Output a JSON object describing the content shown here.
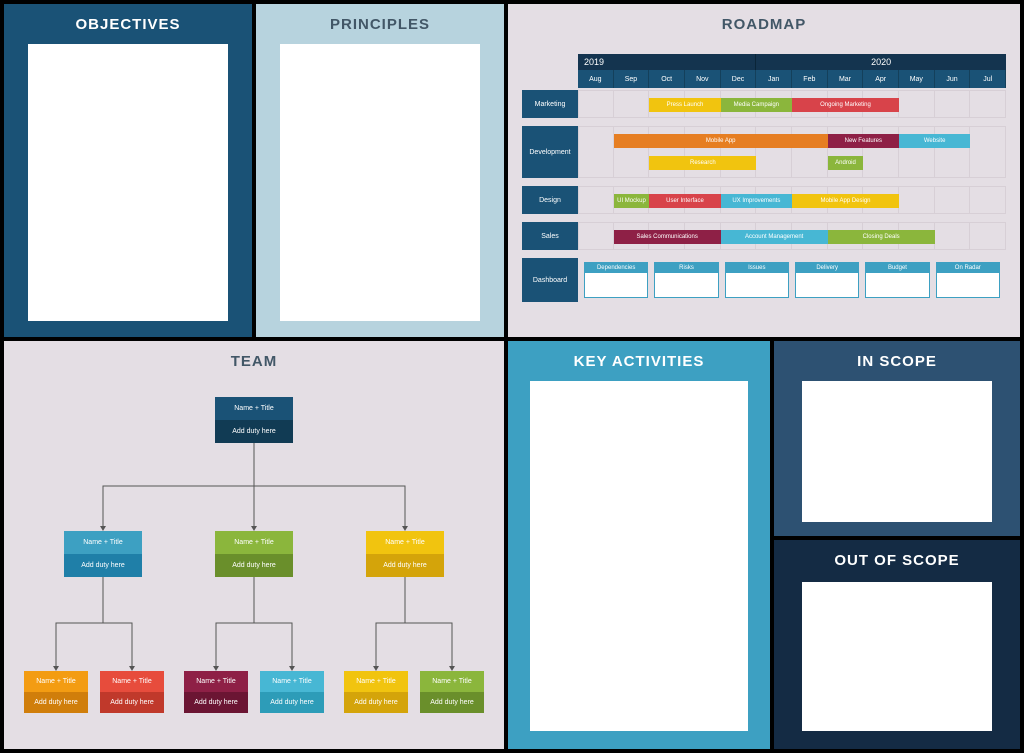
{
  "panels": {
    "objectives": "OBJECTIVES",
    "principles": "PRINCIPLES",
    "roadmap": "ROADMAP",
    "team": "TEAM",
    "key_activities": "KEY ACTIVITIES",
    "in_scope": "IN SCOPE",
    "out_of_scope": "OUT OF SCOPE"
  },
  "roadmap": {
    "years": [
      "2019",
      "2020"
    ],
    "months": [
      "Aug",
      "Sep",
      "Oct",
      "Nov",
      "Dec",
      "Jan",
      "Feb",
      "Mar",
      "Apr",
      "May",
      "Jun",
      "Jul"
    ],
    "rows": {
      "marketing": {
        "label": "Marketing",
        "items": [
          {
            "label": "Press Launch",
            "start": 2,
            "span": 2,
            "color": "#f1c40f"
          },
          {
            "label": "Media Campaign",
            "start": 4,
            "span": 2,
            "color": "#8bb63c"
          },
          {
            "label": "Ongoing Marketing",
            "start": 6,
            "span": 3,
            "color": "#d8434a"
          }
        ]
      },
      "development": {
        "label": "Development",
        "items_row1": [
          {
            "label": "Mobile App",
            "start": 1,
            "span": 6,
            "color": "#e67e22"
          },
          {
            "label": "New Features",
            "start": 7,
            "span": 2,
            "color": "#8e2046"
          },
          {
            "label": "Website",
            "start": 9,
            "span": 2,
            "color": "#47b7d4"
          }
        ],
        "items_row2": [
          {
            "label": "Research",
            "start": 2,
            "span": 3,
            "color": "#f1c40f"
          },
          {
            "label": "Android",
            "start": 7,
            "span": 1,
            "color": "#8bb63c"
          }
        ]
      },
      "design": {
        "label": "Design",
        "items": [
          {
            "label": "UI Mockup",
            "start": 1,
            "span": 1,
            "color": "#8bb63c"
          },
          {
            "label": "User Interface",
            "start": 2,
            "span": 2,
            "color": "#d8434a"
          },
          {
            "label": "UX Improvements",
            "start": 4,
            "span": 2,
            "color": "#47b7d4"
          },
          {
            "label": "Mobile App Design",
            "start": 6,
            "span": 3,
            "color": "#f1c40f"
          }
        ]
      },
      "sales": {
        "label": "Sales",
        "items": [
          {
            "label": "Sales Communications",
            "start": 1,
            "span": 3,
            "color": "#8e2046"
          },
          {
            "label": "Account Management",
            "start": 4,
            "span": 3,
            "color": "#47b7d4"
          },
          {
            "label": "Closing Deals",
            "start": 7,
            "span": 3,
            "color": "#8bb63c"
          }
        ]
      },
      "dashboard": {
        "label": "Dashboard",
        "cards": [
          "Dependencies",
          "Risks",
          "Issues",
          "Delivery",
          "Budget",
          "On Radar"
        ]
      }
    }
  },
  "team": {
    "root": {
      "title": "Name + Title",
      "duty": "Add duty here",
      "c1": "#1a5276",
      "c2": "#113b54"
    },
    "l2": [
      {
        "title": "Name + Title",
        "duty": "Add duty here",
        "c1": "#3da0c2",
        "c2": "#1f7fa8"
      },
      {
        "title": "Name + Title",
        "duty": "Add duty here",
        "c1": "#8bb63c",
        "c2": "#6a8f2b"
      },
      {
        "title": "Name + Title",
        "duty": "Add duty here",
        "c1": "#f1c40f",
        "c2": "#d4a40a"
      }
    ],
    "l3": [
      {
        "title": "Name + Title",
        "duty": "Add duty here",
        "c1": "#f39c12",
        "c2": "#d07e0b"
      },
      {
        "title": "Name + Title",
        "duty": "Add duty here",
        "c1": "#e74c3c",
        "c2": "#c0392b"
      },
      {
        "title": "Name + Title",
        "duty": "Add duty here",
        "c1": "#8e2046",
        "c2": "#6b1533"
      },
      {
        "title": "Name + Title",
        "duty": "Add duty here",
        "c1": "#47b7d4",
        "c2": "#2d9cb8"
      },
      {
        "title": "Name + Title",
        "duty": "Add duty here",
        "c1": "#f1c40f",
        "c2": "#d4a40a"
      },
      {
        "title": "Name + Title",
        "duty": "Add duty here",
        "c1": "#8bb63c",
        "c2": "#6a8f2b"
      }
    ]
  }
}
